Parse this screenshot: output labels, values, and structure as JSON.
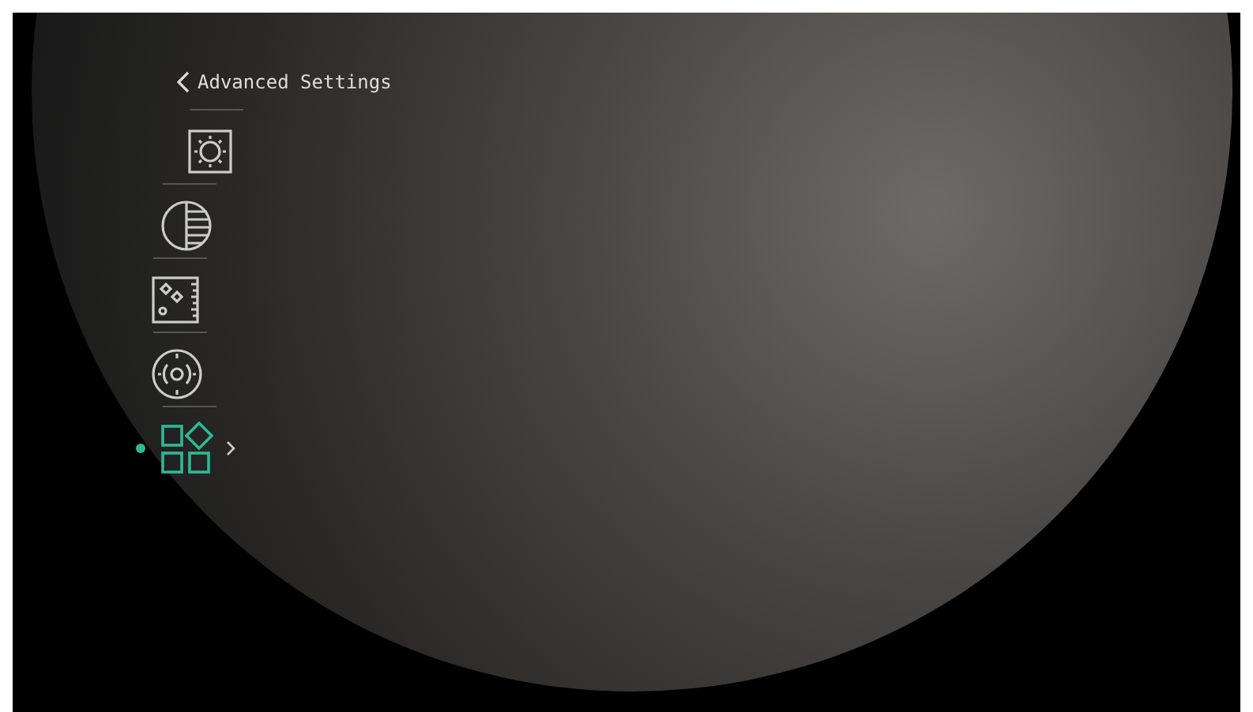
{
  "header": {
    "title": "Advanced Settings"
  },
  "menu": {
    "items": [
      {
        "kind": "brightness",
        "selected": false
      },
      {
        "kind": "contrast",
        "selected": false
      },
      {
        "kind": "image",
        "selected": false
      },
      {
        "kind": "focus",
        "selected": false
      },
      {
        "kind": "apps",
        "selected": true
      }
    ]
  }
}
